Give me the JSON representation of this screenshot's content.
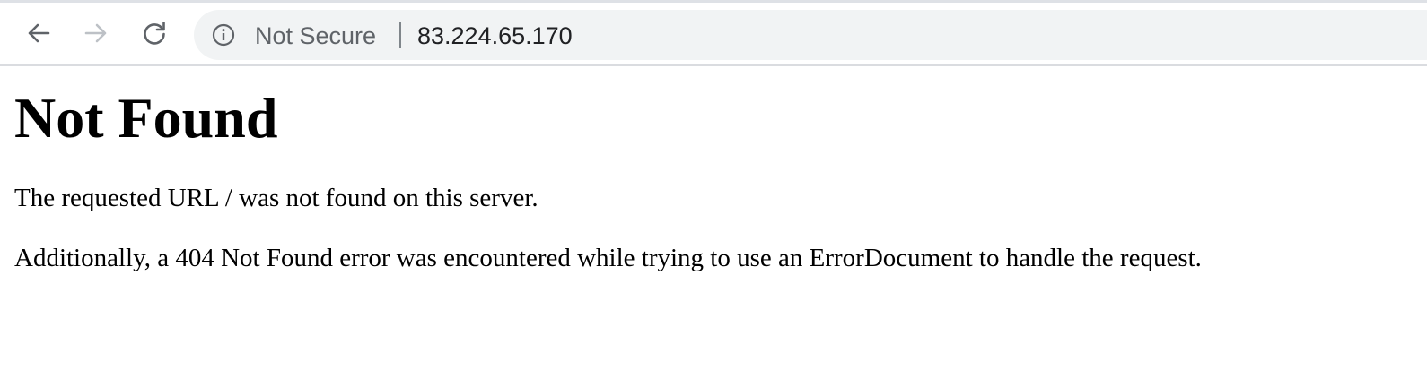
{
  "browser": {
    "nav": {
      "back_icon": "arrow-left-icon",
      "forward_icon": "arrow-right-icon",
      "reload_icon": "reload-icon"
    },
    "omnibox": {
      "security_icon": "info-icon",
      "security_label": "Not Secure",
      "url": "83.224.65.170"
    }
  },
  "page": {
    "heading": "Not Found",
    "message": "The requested URL / was not found on this server.",
    "detail": "Additionally, a 404 Not Found error was encountered while trying to use an ErrorDocument to handle the request."
  },
  "colors": {
    "toolbar_icon": "#5f6368",
    "disabled_icon": "#bdc1c6",
    "omnibox_bg": "#f1f3f4",
    "url_text": "#202124"
  }
}
